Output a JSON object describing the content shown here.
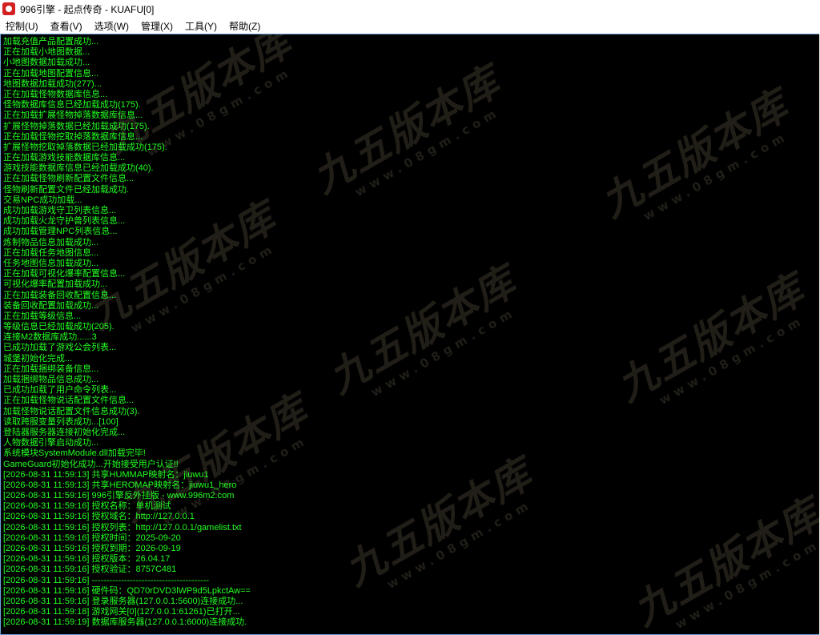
{
  "window": {
    "title": "996引擎 - 起点传奇 - KUAFU[0]",
    "icon": "app-logo-icon"
  },
  "menu": {
    "items": [
      {
        "label": "控制(U)"
      },
      {
        "label": "查看(V)"
      },
      {
        "label": "选项(W)"
      },
      {
        "label": "管理(X)"
      },
      {
        "label": "工具(Y)"
      },
      {
        "label": "帮助(Z)"
      }
    ]
  },
  "colors": {
    "console_bg": "#000000",
    "console_text": "#22ff22",
    "frame_border": "#6fa3d8"
  },
  "watermark": {
    "main": "九五版本库",
    "sub": "www.08gm.com"
  },
  "log": [
    "加载充值产品配置成功...",
    "正在加载小地图数据...",
    "小地图数据加载成功...",
    "正在加载地图配置信息...",
    "地图数据加载成功(277)...",
    "正在加载怪物数据库信息...",
    "怪物数据库信息已经加载成功(175).",
    "正在加载扩展怪物掉落数据库信息...",
    "扩展怪物掉落数据已经加载成功(175).",
    "正在加载怪物挖取掉落数据库信息...",
    "扩展怪物挖取掉落数据已经加载成功(175).",
    "正在加载游戏技能数据库信息...",
    "游戏技能数据库信息已经加载成功(40).",
    "正在加载怪物刷新配置文件信息...",
    "怪物刷新配置文件已经加载成功.",
    "交易NPC成功加载...",
    "成功加载游戏守卫列表信息...",
    "成功加载火龙守护兽列表信息...",
    "成功加载管理NPC列表信息...",
    "炼制物品信息加载成功...",
    "正在加载任务地图信息...",
    "任务地图信息加载成功...",
    "正在加载可视化爆率配置信息...",
    "可视化爆率配置加载成功...",
    "正在加载装备回收配置信息...",
    "装备回收配置加载成功...",
    "正在加载等级信息...",
    "等级信息已经加载成功(205).",
    "连接M2数据库成功......3",
    "已成功加载了游戏公会列表...",
    "城堡初始化完成...",
    "正在加载捆绑装备信息...",
    "加载捆绑物品信息成功...",
    "已成功加载了用户命令列表...",
    "正在加载怪物说话配置文件信息...",
    "加载怪物说话配置文件信息成功(3).",
    "读取跨服变量列表成功...[100]",
    "登陆器服务器连接初始化完成...",
    "人物数据引擎启动成功...",
    "系统模块SystemModule.dll加载完毕!",
    "GameGuard初始化成功...开始接受用户认证!!",
    "[2026-08-31 11:59:13] 共享HUMMAP映射名：jiuwu1",
    "[2026-08-31 11:59:13] 共享HEROMAP映射名：jiuwu1_hero",
    "[2026-08-31 11:59:16] 996引擎反外挂版 - www.996m2.com",
    "[2026-08-31 11:59:16] 授权名称：单机测试",
    "[2026-08-31 11:59:16] 授权域名：http://127.0.0.1",
    "[2026-08-31 11:59:16] 授权列表：http://127.0.0.1/gamelist.txt",
    "[2026-08-31 11:59:16] 授权时间：2025-09-20",
    "[2026-08-31 11:59:16] 授权到期：2026-09-19",
    "[2026-08-31 11:59:16] 授权版本：26.04.17",
    "[2026-08-31 11:59:16] 授权验证：8757C481",
    "[2026-08-31 11:59:16] ----------------------------------------",
    "[2026-08-31 11:59:16] 硬件码：QD70rDVD3lWP9d5LpkctAw==",
    "[2026-08-31 11:59:16] 登录服务器(127.0.0.1:5600)连接成功...",
    "[2026-08-31 11:59:18] 游戏网关[0](127.0.0.1:61261)已打开...",
    "[2026-08-31 11:59:19] 数据库服务器(127.0.0.1:6000)连接成功."
  ]
}
